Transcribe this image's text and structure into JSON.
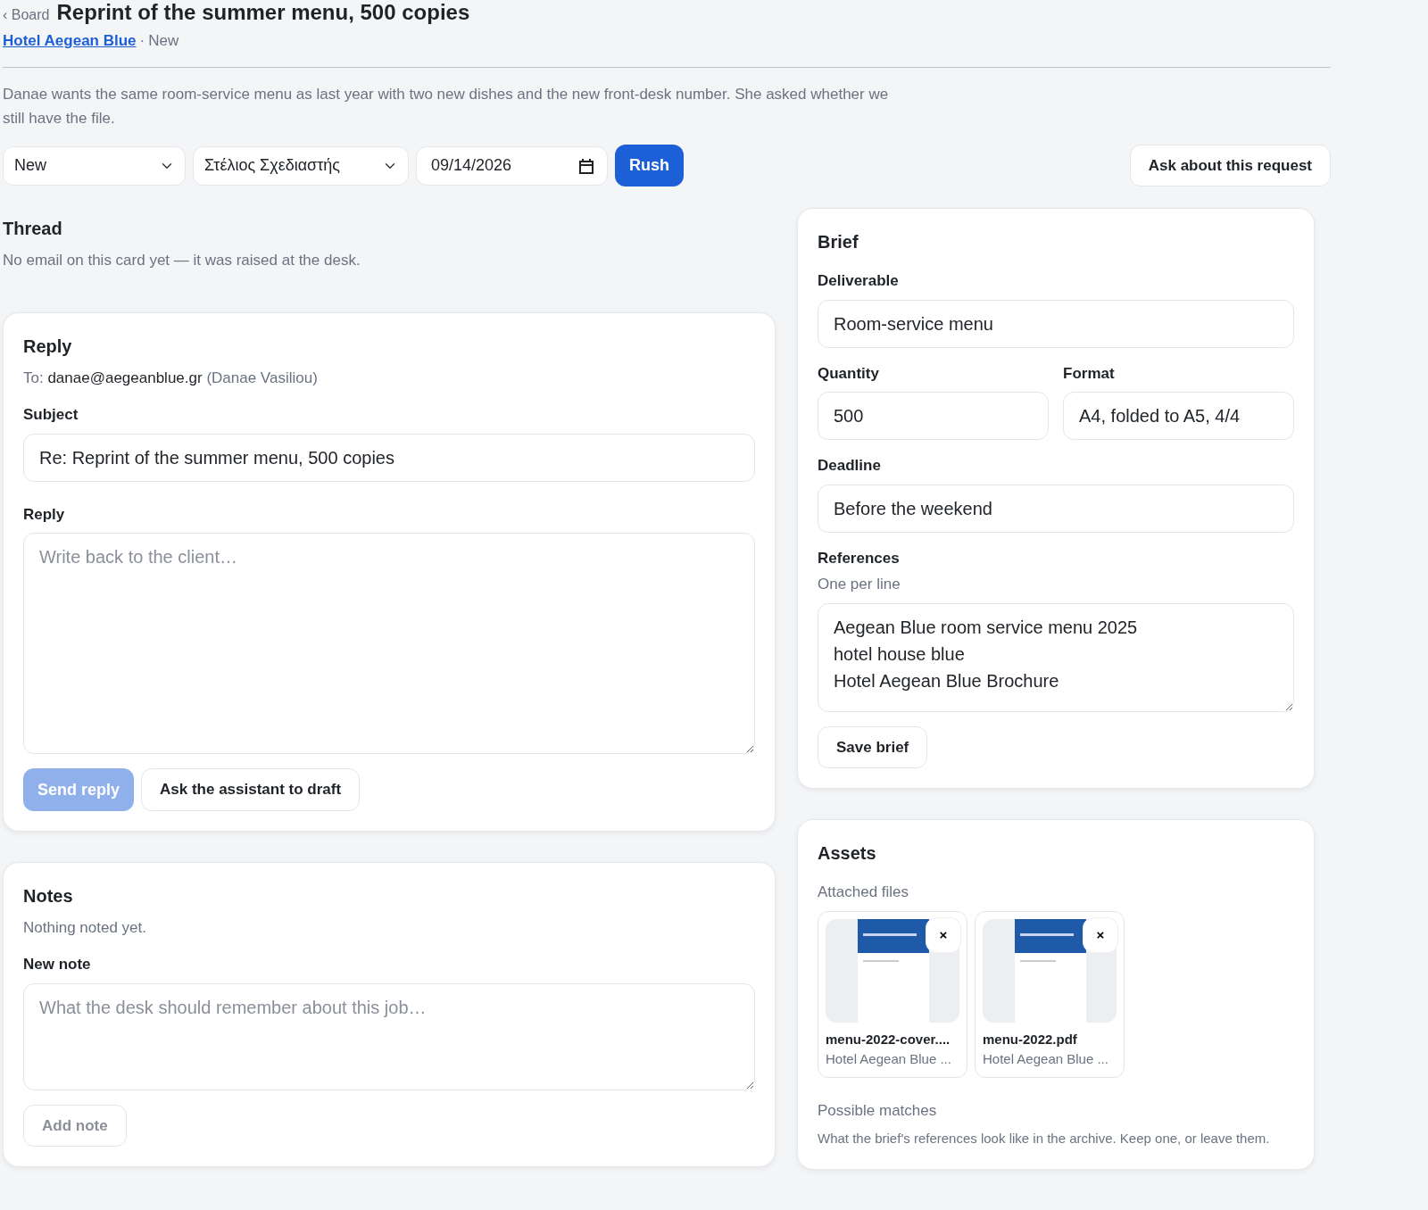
{
  "header": {
    "back_link": "‹ Board",
    "title": "Reprint of the summer menu, 500 copies",
    "client_link": "Hotel Aegean Blue",
    "separator": "·",
    "status_text": "New"
  },
  "description": "Danae wants the same room-service menu as last year with two new dishes and the new front-desk number. She asked whether we still have the file.",
  "controls": {
    "status": {
      "value": "New"
    },
    "assignee": {
      "value": "Στέλιος Σχεδιαστής"
    },
    "due_date": {
      "value": "09/14/2026"
    },
    "rush": {
      "label": "Rush",
      "on": true
    },
    "ask_button": "Ask about this request"
  },
  "thread": {
    "title": "Thread",
    "empty_text": "No email on this card yet — it was raised at the desk."
  },
  "reply": {
    "title": "Reply",
    "to_label": "To:",
    "to_email": "danae@aegeanblue.gr",
    "to_name": "(Danae Vasiliou)",
    "subject_label": "Subject",
    "subject_value": "Re: Reprint of the summer menu, 500 copies",
    "body_label": "Reply",
    "body_placeholder": "Write back to the client…",
    "send_button": {
      "label": "Send reply",
      "disabled": true
    },
    "draft_button": "Ask the assistant to draft"
  },
  "notes": {
    "title": "Notes",
    "empty_text": "Nothing noted yet.",
    "new_label": "New note",
    "placeholder": "What the desk should remember about this job…",
    "add_button": {
      "label": "Add note",
      "disabled": true
    }
  },
  "brief": {
    "title": "Brief",
    "deliverable_label": "Deliverable",
    "deliverable": "Room-service menu",
    "quantity_label": "Quantity",
    "quantity": "500",
    "format_label": "Format",
    "format": "A4, folded to A5, 4/4",
    "deadline_label": "Deadline",
    "deadline": "Before the weekend",
    "references_label": "References",
    "references_hint": "One per line",
    "references": "Aegean Blue room service menu 2025\nhotel house blue\nHotel Aegean Blue Brochure",
    "save_button": "Save brief"
  },
  "assets": {
    "title": "Assets",
    "attached_label": "Attached files",
    "files": [
      {
        "name": "menu-2022-cover....",
        "source": "Hotel Aegean Blue ...",
        "remove": "×"
      },
      {
        "name": "menu-2022.pdf",
        "source": "Hotel Aegean Blue ...",
        "remove": "×"
      }
    ],
    "matches_label": "Possible matches",
    "matches_text": "What the brief's references look like in the archive. Keep one, or leave them."
  }
}
